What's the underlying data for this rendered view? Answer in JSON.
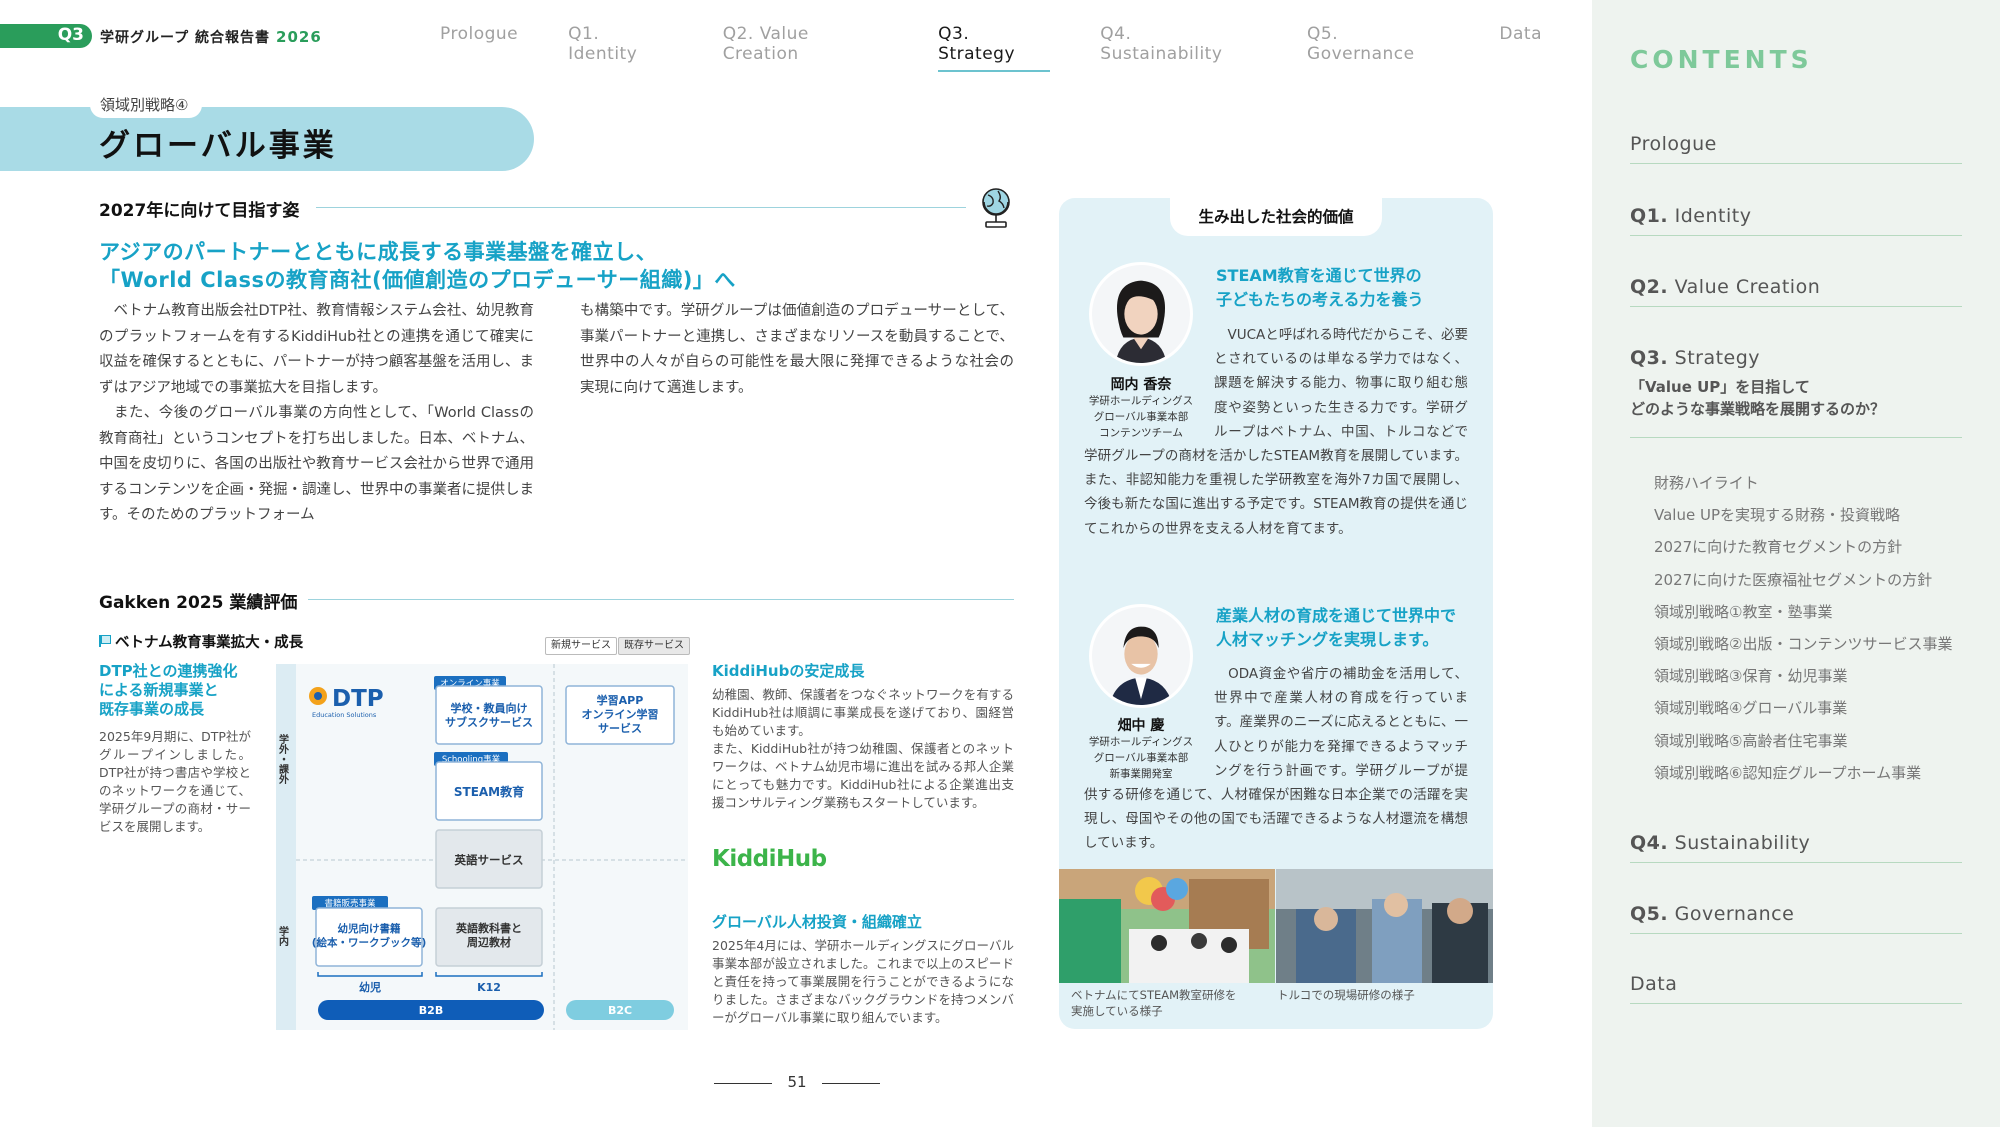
{
  "header": {
    "section_tag": "Q3",
    "doc_title": "学研グループ 統合報告書",
    "doc_year": "2026",
    "nav": [
      "Prologue",
      "Q1. Identity",
      "Q2. Value Creation",
      "Q3. Strategy",
      "Q4. Sustainability",
      "Q5. Governance",
      "Data"
    ],
    "active_nav": "Q3. Strategy"
  },
  "section": {
    "kicker": "領域別戦略④",
    "title": "グローバル事業"
  },
  "vision": {
    "heading": "2027年に向けて目指す姿",
    "lead_line1": "アジアのパートナーとともに成長する事業基盤を確立し、",
    "lead_line2": "「World Classの教育商社(価値創造のプロデューサー組織)」へ",
    "col1": "　ベトナム教育出版会社DTP社、教育情報システム会社、幼児教育のプラットフォームを有するKiddiHub社との連携を通じて確実に収益を確保するとともに、パートナーが持つ顧客基盤を活用し、まずはアジア地域での事業拡大を目指します。\n　また、今後のグローバル事業の方向性として、「World Classの教育商社」というコンセプトを打ち出しました。日本、ベトナム、中国を皮切りに、各国の出版社や教育サービス会社から世界で通用するコンテンツを企画・発掘・調達し、世界中の事業者に提供します。そのためのプラットフォーム",
    "col2": "も構築中です。学研グループは価値創造のプロデューサーとして、事業パートナーと連携し、さまざまなリソースを動員することで、世界中の人々が自らの可能性を最大限に発揮できるような社会の実現に向けて邁進します。"
  },
  "evaluation": {
    "heading": "Gakken 2025 業績評価",
    "vietnam_title": "ベトナム教育事業拡大・成長",
    "dtp_heading": "DTP社との連携強化\nによる新規事業と\n既存事業の成長",
    "dtp_text": "2025年9月期に、DTP社がグループインしました。DTP社が持つ書店や学校とのネットワークを通じて、学研グループの商材・サービスを展開します。",
    "kiddi_heading": "KiddiHubの安定成長",
    "kiddi_text": "幼稚園、教師、保護者をつなぐネットワークを有するKiddiHub社は順調に事業成長を遂げており、園経営も始めています。\nまた、KiddiHub社が持つ幼稚園、保護者とのネットワークは、ベトナム幼児市場に進出を試みる邦人企業にとっても魅力です。KiddiHub社による企業進出支援コンサルティング業務もスタートしています。",
    "kiddi_logo": "KiddiHub",
    "talent_heading": "グローバル人材投資・組織確立",
    "talent_text": "2025年4月には、学研ホールディングスにグローバル事業本部が設立されました。これまで以上のスピードと責任を持って事業展開を行うことができるようになりました。さまざまなバックグラウンドを持つメンバーがグローバル事業に取り組んでいます。"
  },
  "business_map": {
    "legend_new": "新規サービス",
    "legend_existing": "既存サービス",
    "logo_main": "DTP",
    "logo_sub": "Education Solutions",
    "row_outside": "学外・課外",
    "row_inside": "学内",
    "tag_online": "オンライン事業",
    "tag_schooling": "Schooling事業",
    "tag_books": "書籍販売事業",
    "box_subscription": "学校・教員向け\nサブスクサービス",
    "box_steam": "STEAM教育",
    "box_english": "英語サービス",
    "box_textbook": "英語教科書と\n周辺教材",
    "box_kids_books": "幼児向け書籍\n(絵本・ワークブック等)",
    "box_app": "学習APP\nオンライン学習\nサービス",
    "axis_infant": "幼児",
    "axis_k12": "K12",
    "axis_b2b": "B2B",
    "axis_b2c": "B2C"
  },
  "value_box": {
    "title": "生み出した社会的価値",
    "person1": {
      "heading": "STEAM教育を通じて世界の\n子どもたちの考える力を養う",
      "name": "岡内 香奈",
      "dept": "学研ホールディングス\nグローバル事業本部\nコンテンツチーム",
      "text": "　VUCAと呼ばれる時代だからこそ、必要とされているのは単なる学力ではなく、課題を解決する能力、物事に取り組む態度や姿勢といった生きる力です。学研グループはベトナム、中国、トルコなどで学研グループの商材を活かしたSTEAM教育を展開しています。また、非認知能力を重視した学研教室を海外7カ国で展開し、今後も新たな国に進出する予定です。STEAM教育の提供を通じてこれからの世界を支える人材を育てます。"
    },
    "person2": {
      "heading": "産業人材の育成を通じて世界中で\n人材マッチングを実現します。",
      "name": "畑中 慶",
      "dept": "学研ホールディングス\nグローバル事業本部\n新事業開発室",
      "text": "　ODA資金や省庁の補助金を活用して、世界中で産業人材の育成を行っています。産業界のニーズに応えるとともに、一人ひとりが能力を発揮できるようマッチングを行う計画です。学研グループが提供する研修を通じて、人材確保が困難な日本企業での活躍を実現し、母国やその他の国でも活躍できるような人材還流を構想しています。"
    },
    "caption1": "ベトナムにてSTEAM教室研修を\n実施している様子",
    "caption2": "トルコでの現場研修の様子"
  },
  "page_number": "51",
  "sidebar": {
    "heading": "CONTENTS",
    "items": [
      {
        "q": "",
        "label": "Prologue"
      },
      {
        "q": "Q1.",
        "label": " Identity"
      },
      {
        "q": "Q2.",
        "label": " Value Creation"
      },
      {
        "q": "Q3.",
        "label": " Strategy"
      },
      {
        "q": "Q4.",
        "label": " Sustainability"
      },
      {
        "q": "Q5.",
        "label": " Governance"
      },
      {
        "q": "",
        "label": "Data"
      }
    ],
    "strategy_sub": "「Value UP」を目指して\nどのような事業戦略を展開するのか？",
    "strategy_list": [
      "財務ハイライト",
      "Value UPを実現する財務・投資戦略",
      "2027に向けた教育セグメントの方針",
      "2027に向けた医療福祉セグメントの方針",
      "領域別戦略①教室・塾事業",
      "領域別戦略②出版・コンテンツサービス事業",
      "領域別戦略③保育・幼児事業",
      "領域別戦略④グローバル事業",
      "領域別戦略⑤高齢者住宅事業",
      "領域別戦略⑥認知症グループホーム事業"
    ]
  },
  "colors": {
    "accent_green": "#2a9d5b",
    "accent_blue": "#17a2c6",
    "band": "#a9dbe6",
    "value_bg": "#e2f2f7",
    "sidebar_bg": "#eef3ef",
    "contents_green": "#7ec99a"
  },
  "icons": [
    "globe-icon",
    "flag-icon",
    "steam-class-photo",
    "turkey-training-photo"
  ]
}
